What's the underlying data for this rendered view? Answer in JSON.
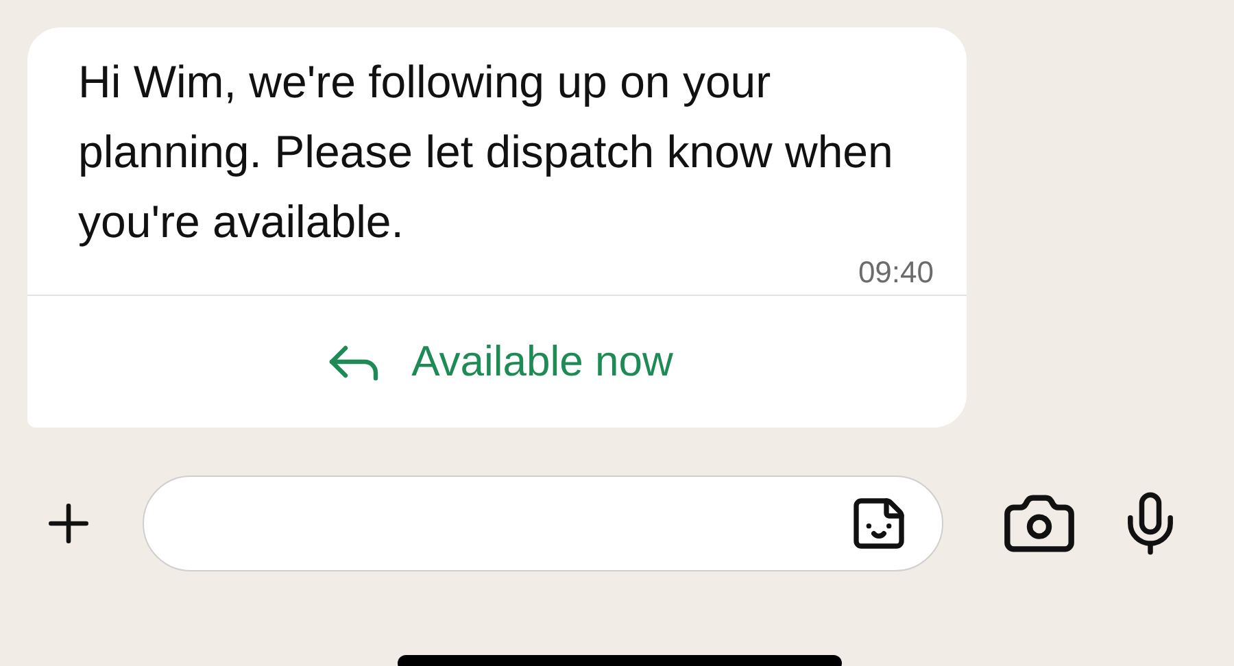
{
  "message": {
    "text": "Hi Wim, we're following up on your planning. Please let dispatch know when you're available.",
    "time": "09:40",
    "quick_reply": "Available now"
  }
}
